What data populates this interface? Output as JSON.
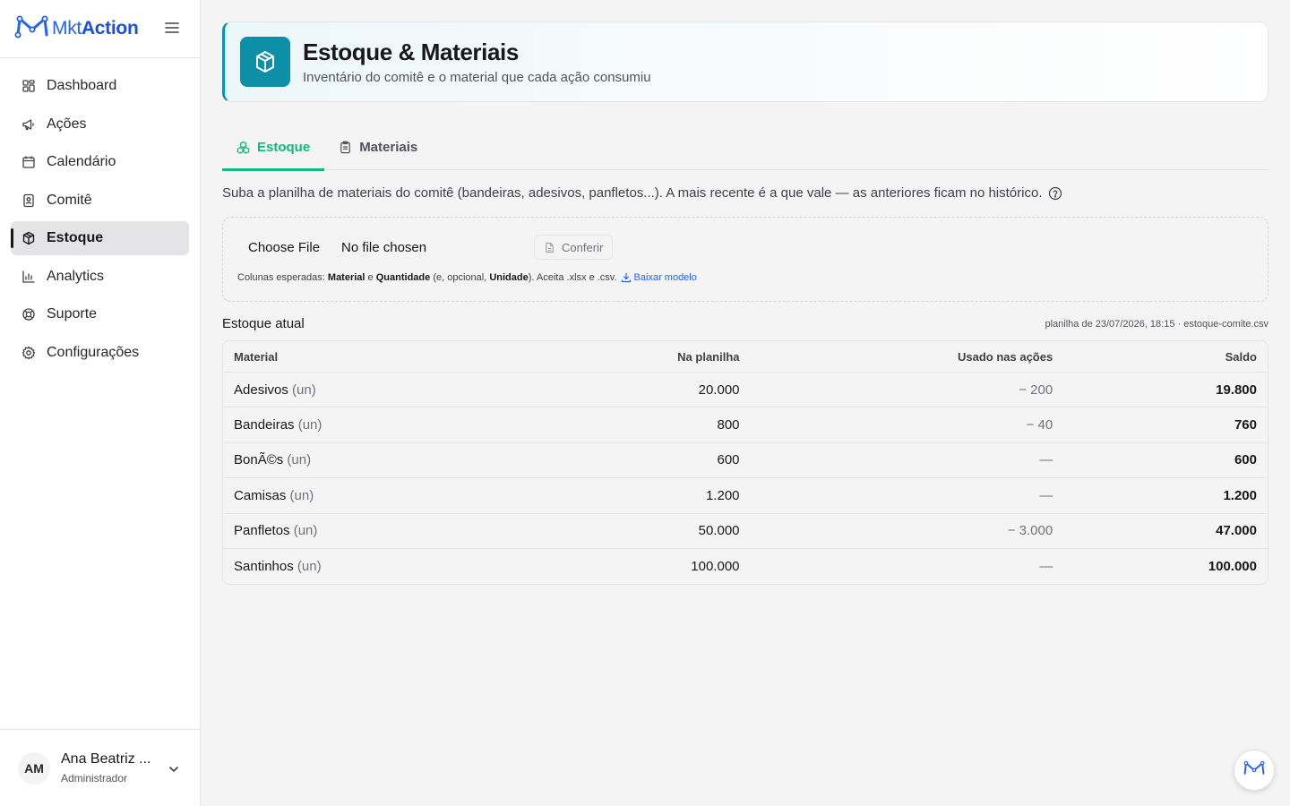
{
  "app": {
    "brand_mkt": "Mkt",
    "brand_action": "Action",
    "accent": "#10b981",
    "brand_color": "#2563eb",
    "header_icon_color": "#0e8fa8"
  },
  "sidebar": {
    "items": [
      {
        "label": "Dashboard",
        "icon": "grid-icon"
      },
      {
        "label": "Ações",
        "icon": "megaphone-icon"
      },
      {
        "label": "Calendário",
        "icon": "calendar-icon"
      },
      {
        "label": "Comitê",
        "icon": "badge-icon"
      },
      {
        "label": "Estoque",
        "icon": "box-icon",
        "active": true
      },
      {
        "label": "Analytics",
        "icon": "bar-chart-icon"
      },
      {
        "label": "Suporte",
        "icon": "lifebuoy-icon"
      },
      {
        "label": "Configurações",
        "icon": "gear-icon"
      }
    ]
  },
  "user": {
    "initials": "AM",
    "name": "Ana Beatriz ...",
    "role": "Administrador"
  },
  "header": {
    "title": "Estoque & Materiais",
    "subtitle": "Inventário do comitê e o material que cada ação consumiu"
  },
  "tabs": [
    {
      "label": "Estoque",
      "active": true
    },
    {
      "label": "Materiais",
      "active": false
    }
  ],
  "upload": {
    "description": "Suba a planilha de materiais do comitê (bandeiras, adesivos, panfletos...). A mais recente é a que vale — as anteriores ficam no histórico.",
    "choose_label": "Choose File",
    "no_file": "No file chosen",
    "conferir": "Conferir",
    "hint_prefix": "Colunas esperadas:",
    "hint_material": "Material",
    "hint_e": "e",
    "hint_quantidade": "Quantidade",
    "hint_opt": "(e, opcional,",
    "hint_unidade": "Unidade",
    "hint_suffix": "). Aceita .xlsx e .csv.",
    "download_label": "Baixar modelo"
  },
  "stock": {
    "title": "Estoque atual",
    "meta": "planilha de 23/07/2026, 18:15 · estoque-comite.csv",
    "columns": [
      "Material",
      "Na planilha",
      "Usado nas ações",
      "Saldo"
    ],
    "rows": [
      {
        "material": "Adesivos",
        "unit": "(un)",
        "sheet": "20.000",
        "used": "− 200",
        "balance": "19.800"
      },
      {
        "material": "Bandeiras",
        "unit": "(un)",
        "sheet": "800",
        "used": "− 40",
        "balance": "760"
      },
      {
        "material": "BonÃ©s",
        "unit": "(un)",
        "sheet": "600",
        "used": "—",
        "balance": "600"
      },
      {
        "material": "Camisas",
        "unit": "(un)",
        "sheet": "1.200",
        "used": "—",
        "balance": "1.200"
      },
      {
        "material": "Panfletos",
        "unit": "(un)",
        "sheet": "50.000",
        "used": "− 3.000",
        "balance": "47.000"
      },
      {
        "material": "Santinhos",
        "unit": "(un)",
        "sheet": "100.000",
        "used": "—",
        "balance": "100.000"
      }
    ]
  }
}
